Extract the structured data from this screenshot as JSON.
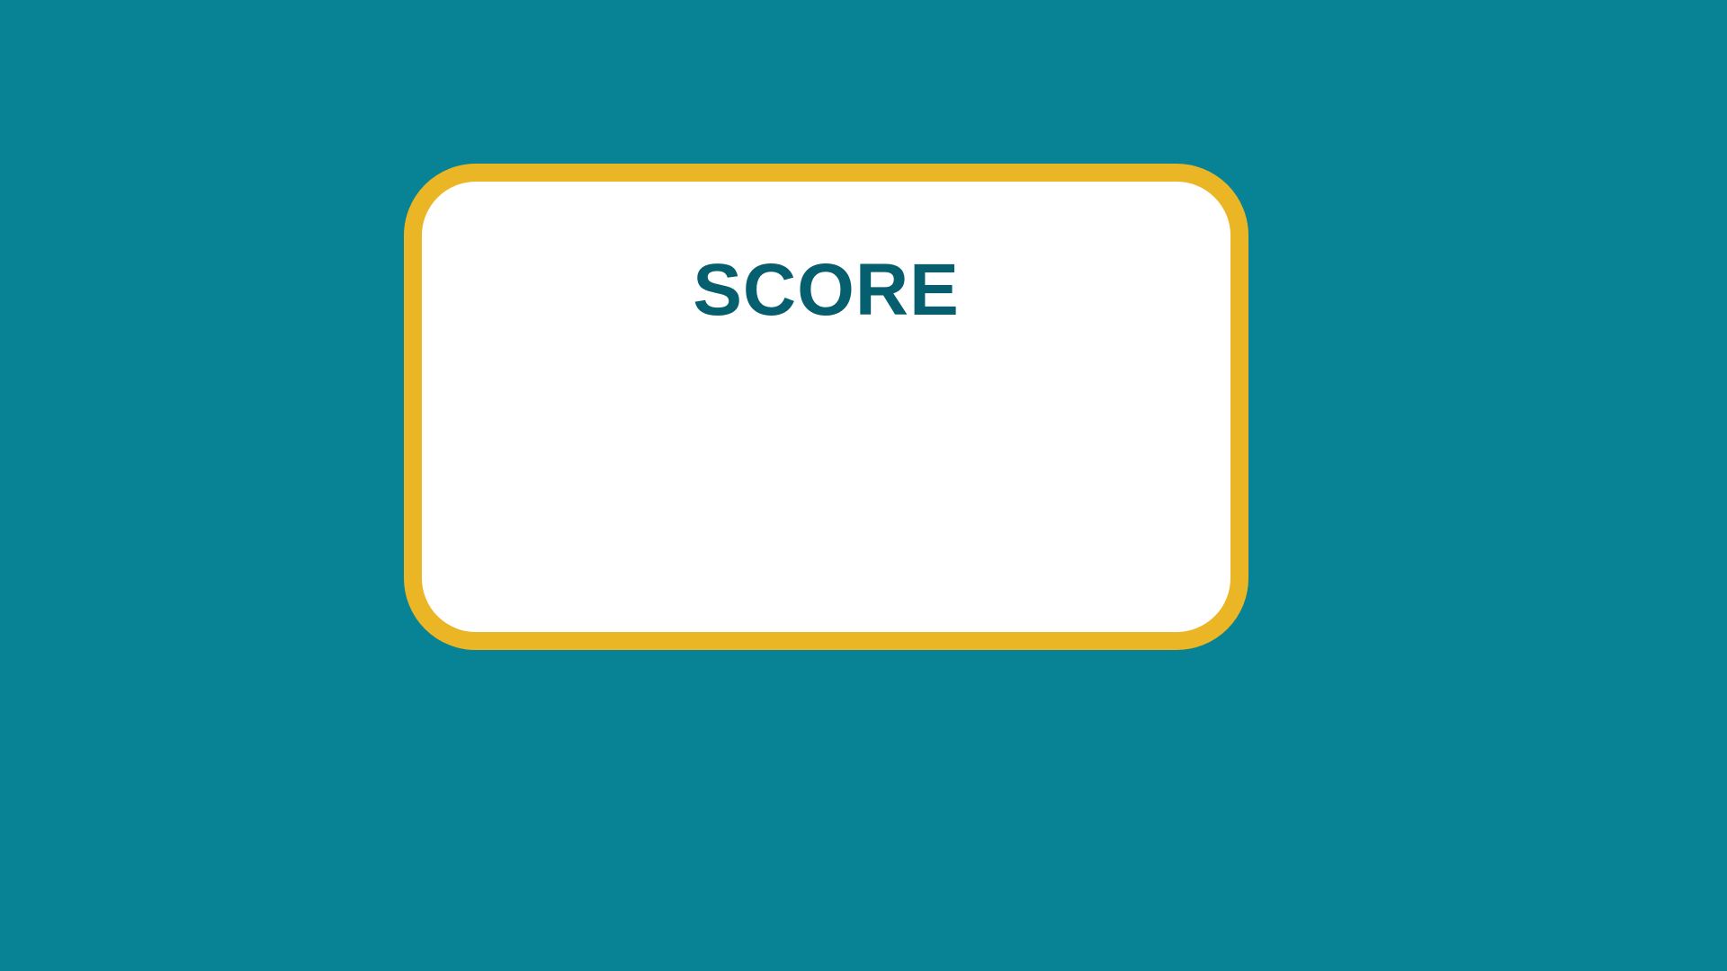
{
  "score_panel": {
    "title": "SCORE"
  },
  "colors": {
    "background": "#088395",
    "card_border": "#ebb625",
    "card_fill": "#ffffff",
    "title_text": "#065f6e"
  }
}
